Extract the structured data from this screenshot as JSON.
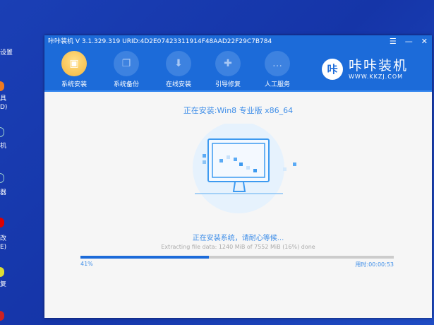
{
  "desktop": {
    "labels": [
      "设置",
      "具",
      "D)",
      "机",
      "器",
      "改",
      "E)",
      "复"
    ]
  },
  "window": {
    "title": "咔咔装机 V 3.1.329.319 URID:4D2E07423311914F48AAD22F29C7B784",
    "menu_icon": "☰",
    "minimize_icon": "—",
    "close_icon": "✕"
  },
  "toolbar": {
    "items": [
      {
        "label": "系统安装",
        "icon": "▣"
      },
      {
        "label": "系统备份",
        "icon": "❐"
      },
      {
        "label": "在线安装",
        "icon": "⬇"
      },
      {
        "label": "引导修复",
        "icon": "✚"
      },
      {
        "label": "人工服务",
        "icon": "…"
      }
    ]
  },
  "logo": {
    "mark": "咔",
    "name": "咔咔装机",
    "url": "WWW.KKZJ.COM"
  },
  "main": {
    "heading": "正在安装:Win8 专业版 x86_64",
    "status": "正在安装系统，请耐心等候...",
    "detail": "Extracting file data: 1240 MiB of 7552 MiB (16%) done",
    "progress_percent": 41,
    "progress_label": "41%",
    "elapsed": "用时:00:00:53"
  },
  "colors": {
    "accent": "#1c6bd9",
    "text_blue": "#3d8de8"
  }
}
